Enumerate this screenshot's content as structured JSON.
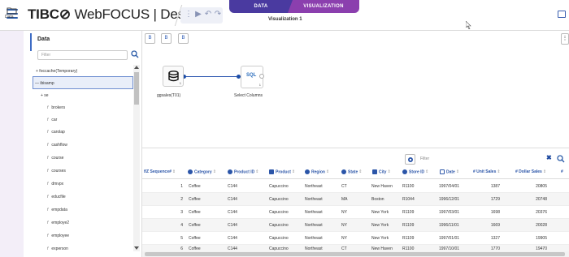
{
  "header": {
    "brand_bold": "TIBC",
    "brand_mark": "⊘",
    "brand_product": " WebFOCUS",
    "brand_divider": " | ",
    "brand_app": "Designer",
    "toolbar_icons": [
      "run-icon",
      "play-icon",
      "undo-icon",
      "redo-icon"
    ],
    "mode_tabs": [
      {
        "label": "DATA"
      },
      {
        "label": "VISUALIZATION"
      }
    ],
    "subtitle": "Visualization 1"
  },
  "left_strip": {
    "label": "Data"
  },
  "data_panel": {
    "title": "Data",
    "filter_placeholder": "Filter",
    "tree": [
      {
        "label": "+ foccache(Temporary)",
        "type": "folder"
      },
      {
        "label": "— ibisamp",
        "type": "folder",
        "selected": true
      },
      {
        "label": "+ se",
        "type": "folder"
      },
      {
        "label": "brokers",
        "type": "table"
      },
      {
        "label": "car",
        "type": "table"
      },
      {
        "label": "carolap",
        "type": "table"
      },
      {
        "label": "cashflow",
        "type": "table"
      },
      {
        "label": "course",
        "type": "table"
      },
      {
        "label": "courses",
        "type": "table"
      },
      {
        "label": "dmvpx",
        "type": "table"
      },
      {
        "label": "educfile",
        "type": "table"
      },
      {
        "label": "empdata",
        "type": "table"
      },
      {
        "label": "employe2",
        "type": "table"
      },
      {
        "label": "employee",
        "type": "table"
      },
      {
        "label": "experson",
        "type": "table"
      }
    ]
  },
  "flow": {
    "tool_buttons": [
      "B",
      "B",
      "B"
    ],
    "source_node_label": "ggsales(T01)",
    "source_node_count": "1",
    "sql_node_text": "SQL",
    "sql_node_count": "1",
    "sql_node_label": "Select Columns"
  },
  "grid": {
    "filter_placeholder": "Filter",
    "columns": [
      {
        "label": "Sequence#",
        "icon": "text"
      },
      {
        "label": "Category",
        "icon": "dimension"
      },
      {
        "label": "Product ID",
        "icon": "dimension"
      },
      {
        "label": "Product",
        "icon": "dim-square"
      },
      {
        "label": "Region",
        "icon": "dimension"
      },
      {
        "label": "State",
        "icon": "dimension"
      },
      {
        "label": "City",
        "icon": "dim-square"
      },
      {
        "label": "Store ID",
        "icon": "dimension"
      },
      {
        "label": "Date",
        "icon": "date"
      },
      {
        "label": "Unit Sales",
        "icon": "measure"
      },
      {
        "label": "Dollar Sales",
        "icon": "measure"
      },
      {
        "label": "#",
        "icon": "measure"
      }
    ],
    "rows": [
      [
        "1",
        "Coffee",
        "C144",
        "Capuccino",
        "Northeast",
        "CT",
        "New Haven",
        "R1100",
        "1997/04/01",
        "1387",
        "20805"
      ],
      [
        "2",
        "Coffee",
        "C144",
        "Capuccino",
        "Northeast",
        "MA",
        "Boston",
        "R1044",
        "1996/12/01",
        "1729",
        "20748"
      ],
      [
        "3",
        "Coffee",
        "C144",
        "Capuccino",
        "Northeast",
        "NY",
        "New York",
        "R1109",
        "1997/03/01",
        "1698",
        "20376"
      ],
      [
        "4",
        "Coffee",
        "C144",
        "Capuccino",
        "Northeast",
        "NY",
        "New York",
        "R1109",
        "1996/11/01",
        "1669",
        "20028"
      ],
      [
        "5",
        "Coffee",
        "C144",
        "Capuccino",
        "Northeast",
        "NY",
        "New York",
        "R1109",
        "1997/01/01",
        "1327",
        "19905"
      ],
      [
        "6",
        "Coffee",
        "C144",
        "Capuccino",
        "Northeast",
        "CT",
        "New Haven",
        "R1100",
        "1997/10/01",
        "1770",
        "19470"
      ]
    ]
  }
}
